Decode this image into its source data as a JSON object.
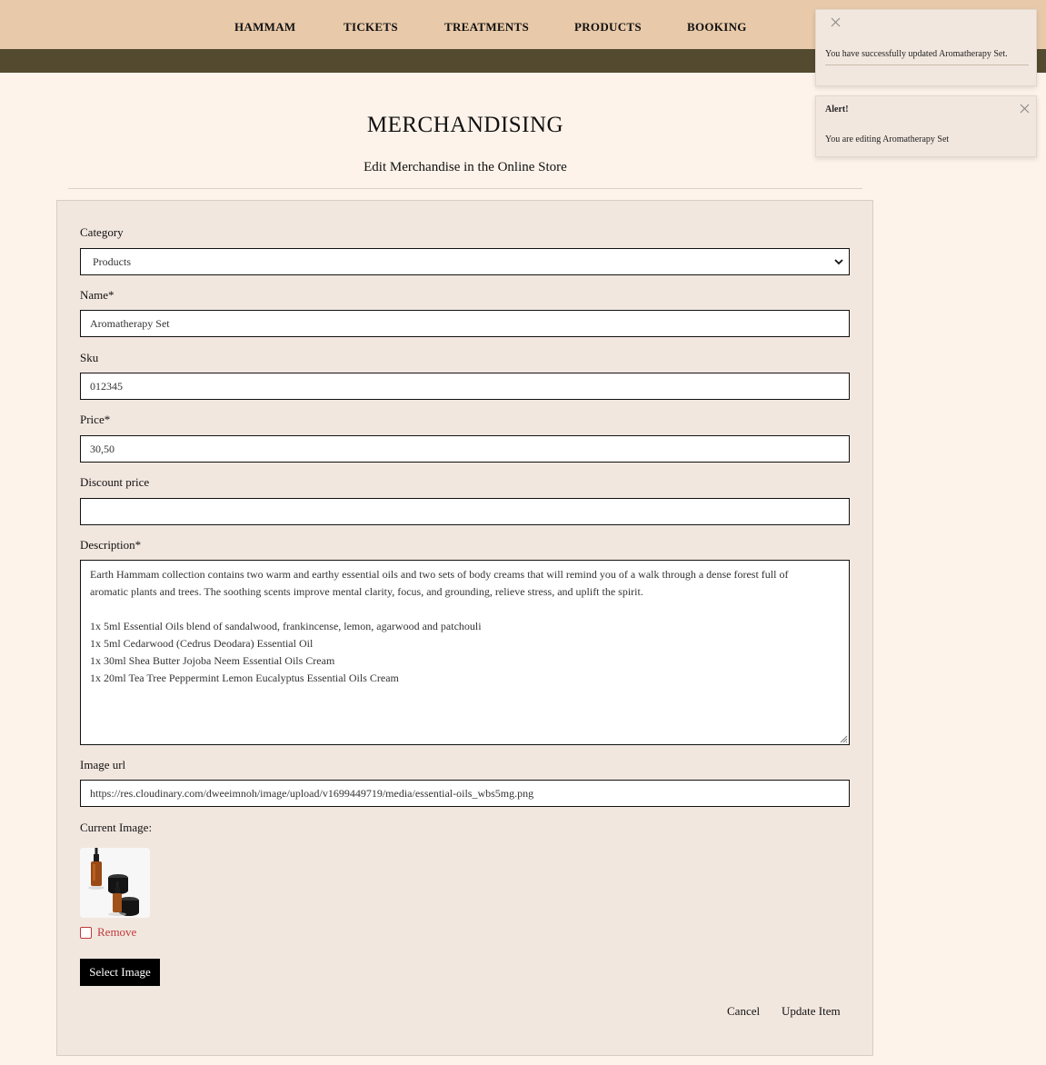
{
  "nav": {
    "items": [
      "HAMMAM",
      "TICKETS",
      "TREATMENTS",
      "PRODUCTS",
      "BOOKING"
    ]
  },
  "page": {
    "title": "MERCHANDISING",
    "subtitle": "Edit Merchandise in the Online Store"
  },
  "form": {
    "category_label": "Category",
    "category_value": "Products",
    "name_label": "Name*",
    "name_value": "Aromatherapy Set",
    "sku_label": "Sku",
    "sku_value": "012345",
    "price_label": "Price*",
    "price_value": "30,50",
    "discount_label": "Discount price",
    "discount_value": "",
    "description_label": "Description*",
    "description_lines": [
      "Earth Hammam collection contains two warm and earthy essential oils and two sets of body creams that will remind you of a walk through a dense forest full of",
      "aromatic plants and trees. The soothing scents improve mental clarity, focus, and grounding, relieve stress, and uplift the spirit.",
      "",
      "1x 5ml Essential Oils blend of sandalwood, frankincense, lemon, agarwood and patchouli",
      "1x 5ml Cedarwood (Cedrus Deodara) Essential Oil",
      "1x 30ml Shea Butter Jojoba Neem Essential Oils Cream",
      "1x 20ml Tea Tree Peppermint Lemon Eucalyptus Essential Oils Cream"
    ],
    "image_url_label": "Image url",
    "image_url_value": "https://res.cloudinary.com/dweeimnoh/image/upload/v1699449719/media/essential-oils_wbs5mg.png",
    "current_image_label": "Current Image:",
    "remove_label": "Remove",
    "remove_checked": false,
    "select_image_label": "Select Image",
    "cancel_label": "Cancel",
    "update_label": "Update Item"
  },
  "toasts": {
    "success_message": "You have successfully updated Aromatherapy Set.",
    "alert_title": "Alert!",
    "alert_message": "You are editing Aromatherapy Set"
  },
  "colors": {
    "nav_bg": "#e8c9a9",
    "subbar_bg": "#534a30",
    "page_bg": "#fdf3ea",
    "panel_bg": "#f2e7df",
    "remove_red": "#c0393b"
  },
  "icons": {
    "select_chevron": "chevron-down-icon",
    "toast_close": "close-icon",
    "textarea_resize": "resize-grip-icon"
  }
}
